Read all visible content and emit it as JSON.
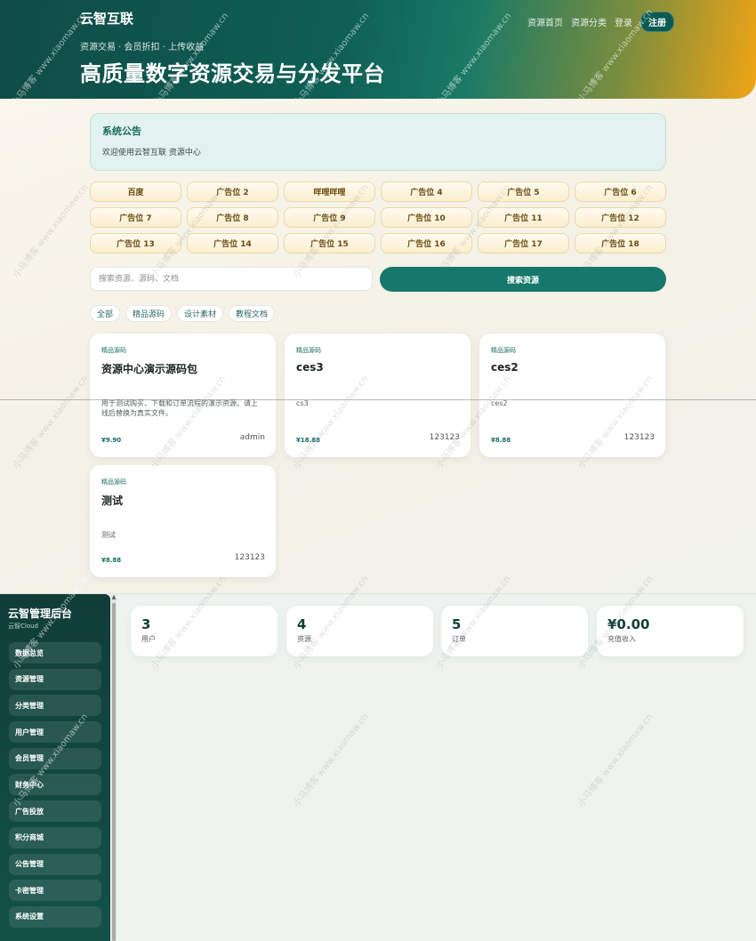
{
  "header": {
    "brand": "云智互联",
    "nav": [
      "资源首页",
      "资源分类",
      "登录"
    ],
    "register": "注册",
    "tagline": "资源交易 · 会员折扣 · 上传收益",
    "title": "高质量数字资源交易与分发平台"
  },
  "notice": {
    "title": "系统公告",
    "text": "欢迎使用云智互联 资源中心"
  },
  "ads": [
    "百度",
    "广告位 2",
    "咩哩咩哩",
    "广告位 4",
    "广告位 5",
    "广告位 6",
    "广告位 7",
    "广告位 8",
    "广告位 9",
    "广告位 10",
    "广告位 11",
    "广告位 12",
    "广告位 13",
    "广告位 14",
    "广告位 15",
    "广告位 16",
    "广告位 17",
    "广告位 18"
  ],
  "search": {
    "placeholder": "搜索资源、源码、文档",
    "button": "搜索资源"
  },
  "filters": [
    "全部",
    "精品源码",
    "设计素材",
    "教程文档"
  ],
  "cards": [
    {
      "category": "精品源码",
      "title": "资源中心演示源码包",
      "desc": "用于测试购买、下载和订单流程的演示资源。请上线后替换为真实文件。",
      "price": "¥9.90",
      "author": "admin"
    },
    {
      "category": "精品源码",
      "title": "ces3",
      "desc": "cs3",
      "price": "¥18.88",
      "author": "123123"
    },
    {
      "category": "精品源码",
      "title": "ces2",
      "desc": "ces2",
      "price": "¥8.88",
      "author": "123123"
    },
    {
      "category": "精品源码",
      "title": "测试",
      "desc": "测试",
      "price": "¥8.88",
      "author": "123123"
    }
  ],
  "admin": {
    "title": "云智管理后台",
    "subtitle": "云智Cloud",
    "menu": [
      "数据总览",
      "资源管理",
      "分类管理",
      "用户管理",
      "会员管理",
      "财务中心",
      "广告投放",
      "积分商城",
      "公告管理",
      "卡密管理",
      "系统设置"
    ],
    "stats": [
      {
        "value": "3",
        "label": "用户"
      },
      {
        "value": "4",
        "label": "资源"
      },
      {
        "value": "5",
        "label": "订单"
      },
      {
        "value": "¥0.00",
        "label": "充值收入"
      }
    ]
  },
  "watermark": "小马博客 www.xiaomaw.cn"
}
